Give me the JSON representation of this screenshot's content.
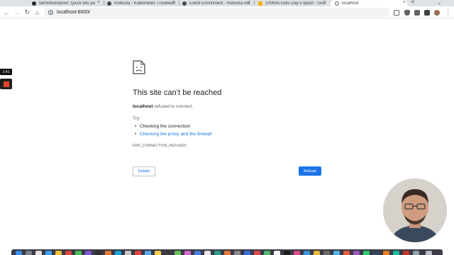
{
  "browser": {
    "tabs": [
      {
        "label": "farmotive/kpoof: Quick k8s po",
        "favicon_color": "#24292e",
        "active": false
      },
      {
        "label": "Robusta - Kubernetes Troublesh",
        "favicon_color": "#444a54",
        "active": false
      },
      {
        "label": "Event Enrichment - Robusta ma",
        "favicon_color": "#444a54",
        "active": false
      },
      {
        "label": "100K8sTools Day 5 kpoof - Goo",
        "favicon_color": "#f4b400",
        "active": false
      },
      {
        "label": "localhost",
        "favicon_color": "#5f6368",
        "active": true
      }
    ],
    "new_tab_label": "+",
    "close_glyph": "×",
    "url": "localhost:8000/"
  },
  "recorder": {
    "time": "1:41"
  },
  "error_page": {
    "title": "This site can’t be reached",
    "host": "localhost",
    "message": " refused to connect.",
    "try_label": "Try:",
    "suggestions": [
      "Checking the connection",
      "Checking the proxy and the firewall"
    ],
    "error_code": "ERR_CONNECTION_REFUSED",
    "details_label": "Details",
    "reload_label": "Reload"
  },
  "colors": {
    "accent": "#1a73e8",
    "text": "#202124",
    "muted": "#5f6368",
    "recorder_stop": "#e8452c"
  }
}
